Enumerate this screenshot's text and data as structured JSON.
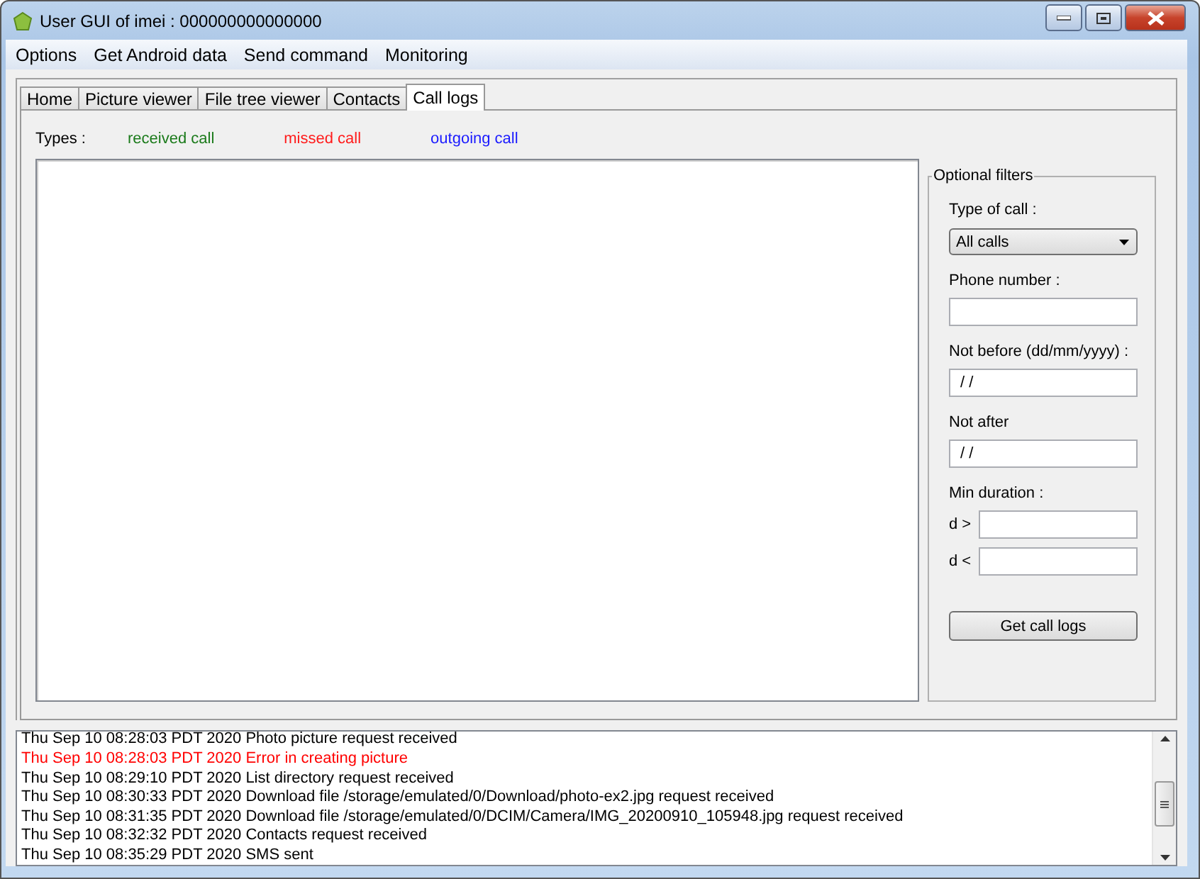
{
  "window": {
    "title": "User GUI of imei : 000000000000000"
  },
  "menu": [
    "Options",
    "Get Android data",
    "Send command",
    "Monitoring"
  ],
  "tabs": [
    {
      "label": "Home",
      "selected": false
    },
    {
      "label": "Picture viewer",
      "selected": false
    },
    {
      "label": "File tree viewer",
      "selected": false
    },
    {
      "label": "Contacts",
      "selected": false
    },
    {
      "label": "Call logs",
      "selected": true
    }
  ],
  "legend": {
    "label": "Types :",
    "items": [
      {
        "label": "received call",
        "color": "#1a7a1a"
      },
      {
        "label": "missed call",
        "color": "#ff1a1a"
      },
      {
        "label": "outgoing call",
        "color": "#1a1aff"
      }
    ]
  },
  "filters": {
    "title": "Optional filters",
    "type_label": "Type of call :",
    "type_value": "All calls",
    "phone_label": "Phone number :",
    "not_before_label": "Not before (dd/mm/yyyy)  :",
    "not_before_value": " / /",
    "not_after_label": "Not after",
    "not_after_value": " / /",
    "duration_label": "Min duration :",
    "min_label": "d >",
    "max_label": "d <",
    "button": "Get call logs"
  },
  "log": [
    {
      "text": "Thu Sep 10 08:28:03 PDT 2020 Photo picture request received",
      "kind": "info"
    },
    {
      "text": "Thu Sep 10 08:28:03 PDT 2020 Error in creating picture",
      "kind": "error"
    },
    {
      "text": "Thu Sep 10 08:29:10 PDT 2020 List directory request received",
      "kind": "info"
    },
    {
      "text": "Thu Sep 10 08:30:33 PDT 2020 Download file /storage/emulated/0/Download/photo-ex2.jpg request received",
      "kind": "info"
    },
    {
      "text": "Thu Sep 10 08:31:35 PDT 2020 Download file /storage/emulated/0/DCIM/Camera/IMG_20200910_105948.jpg request received",
      "kind": "info"
    },
    {
      "text": "Thu Sep 10 08:32:32 PDT 2020 Contacts request received",
      "kind": "info"
    },
    {
      "text": "Thu Sep 10 08:35:29 PDT 2020 SMS sent",
      "kind": "info"
    }
  ]
}
